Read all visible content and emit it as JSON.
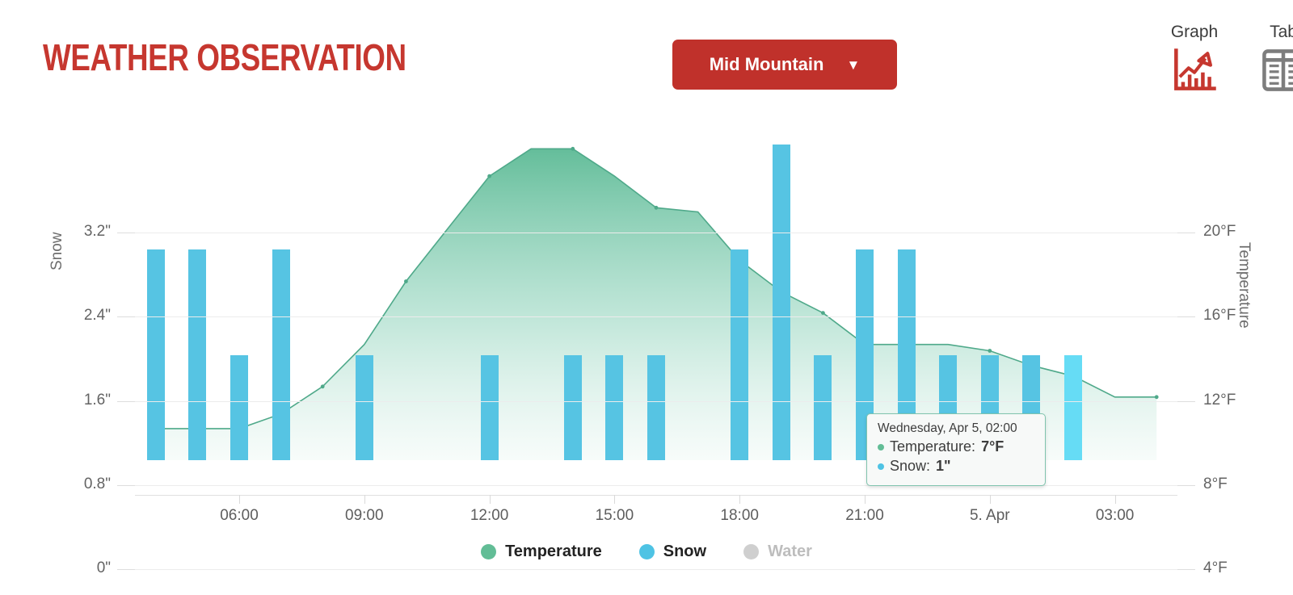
{
  "header": {
    "title": "WEATHER OBSERVATION",
    "station_button": {
      "label": "Mid Mountain",
      "caret": "▼",
      "color": "#c0312b"
    },
    "view_tabs": [
      {
        "label": "Graph",
        "icon": "graph-icon",
        "active": true,
        "color": "#c6372f"
      },
      {
        "label": "Tab",
        "icon": "table-icon",
        "active": false,
        "color": "#7d7d7d"
      }
    ]
  },
  "legend": [
    {
      "label": "Temperature",
      "color": "#62bd96",
      "enabled": true
    },
    {
      "label": "Snow",
      "color": "#4ec3e4",
      "enabled": true
    },
    {
      "label": "Water",
      "color": "#cfcfcf",
      "enabled": false
    }
  ],
  "tooltip": {
    "date": "Wednesday, Apr 5, 02:00",
    "rows": [
      {
        "label": "Temperature:",
        "value": "7°F",
        "color": "#62bd96"
      },
      {
        "label": "Snow:",
        "value": "1\"",
        "color": "#4ec3e4"
      }
    ]
  },
  "chart_data": {
    "type": "line",
    "title": "Weather Observation",
    "xlabel": "",
    "grid": true,
    "legend_position": "bottom",
    "x_tick_labels": [
      "06:00",
      "09:00",
      "12:00",
      "15:00",
      "18:00",
      "21:00",
      "5. Apr",
      "03:00"
    ],
    "axes": {
      "left": {
        "label": "Snow",
        "unit": "\"",
        "tick_labels": [
          "0\"",
          "0.8\"",
          "1.6\"",
          "2.4\"",
          "3.2\""
        ],
        "tick_values": [
          0,
          0.8,
          1.6,
          2.4,
          3.2
        ],
        "ylim": [
          0,
          3.2
        ]
      },
      "right": {
        "label": "Temperature",
        "unit": "°F",
        "tick_labels": [
          "4°F",
          "8°F",
          "12°F",
          "16°F",
          "20°F"
        ],
        "tick_values": [
          4,
          8,
          12,
          16,
          20
        ],
        "ylim": [
          4,
          20
        ]
      }
    },
    "x": [
      "04:00",
      "05:00",
      "06:00",
      "07:00",
      "08:00",
      "09:00",
      "10:00",
      "11:00",
      "12:00",
      "13:00",
      "14:00",
      "15:00",
      "16:00",
      "17:00",
      "18:00",
      "19:00",
      "20:00",
      "21:00",
      "22:00",
      "23:00",
      "00:00",
      "01:00",
      "02:00",
      "03:00",
      "04:00"
    ],
    "series": [
      {
        "name": "Temperature",
        "axis": "right",
        "unit": "°F",
        "color": "#62bd96",
        "type": "area",
        "values": [
          5.5,
          5.5,
          5.5,
          6.2,
          7.5,
          9.5,
          12.5,
          15.0,
          17.5,
          18.8,
          18.8,
          17.5,
          16.0,
          15.8,
          13.5,
          12.0,
          11.0,
          9.5,
          9.5,
          9.5,
          9.2,
          8.5,
          8.0,
          7.0,
          7.0
        ]
      },
      {
        "name": "Snow",
        "axis": "left",
        "unit": "\"",
        "color": "#4ec3e4",
        "type": "bar",
        "values": [
          2,
          2,
          1,
          2,
          0,
          1,
          0,
          0,
          1,
          0,
          1,
          1,
          1,
          0,
          2,
          3,
          1,
          2,
          2,
          1,
          1,
          1,
          1,
          0,
          0
        ]
      },
      {
        "name": "Water",
        "axis": "left",
        "unit": "\"",
        "color": "#cfcfcf",
        "type": "bar",
        "enabled": false,
        "values": []
      }
    ],
    "highlighted_index": 22
  }
}
